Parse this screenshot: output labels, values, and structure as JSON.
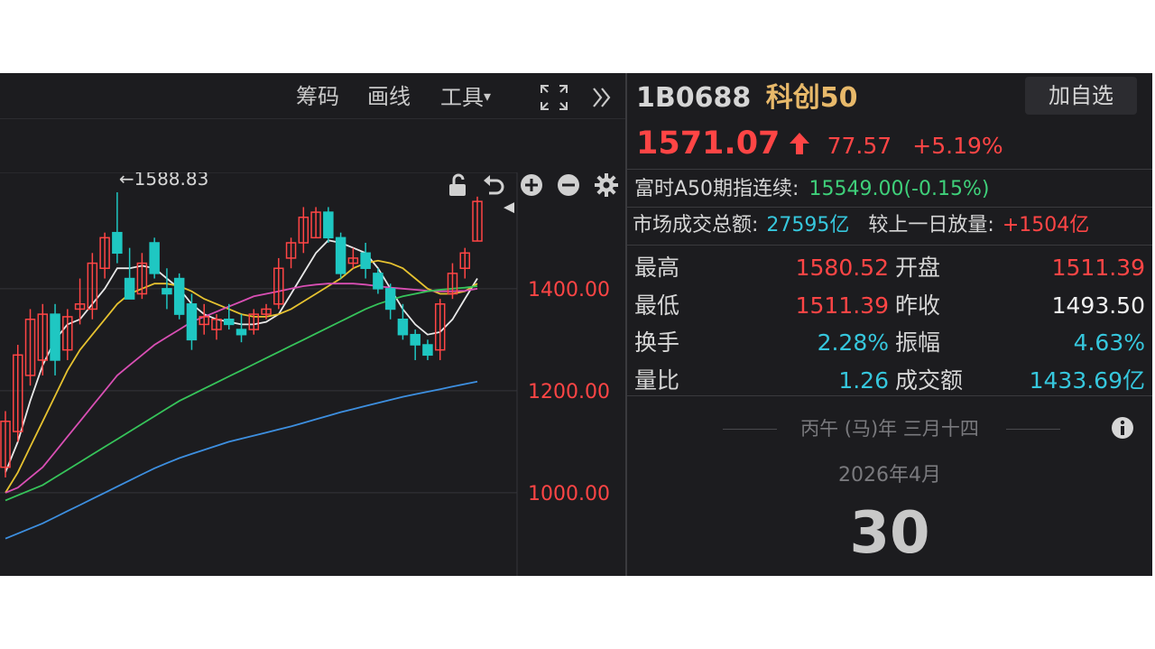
{
  "toolbar": {
    "chips_label": "筹码",
    "draw_label": "画线",
    "tools_label": "工具",
    "tools_caret": "▾",
    "expand_icon": "fullscreen-icon",
    "collapse_icon": "double-chevron-right-icon"
  },
  "subbar_icons": [
    "unlock-icon",
    "undo-icon",
    "zoom-in-icon",
    "zoom-out-icon",
    "gear-icon"
  ],
  "quote": {
    "code": "1B0688",
    "name": "科创50",
    "watch_button": "加自选",
    "price": "1571.07",
    "change": "77.57",
    "change_pct": "+5.19%",
    "a50_label": "富时A50期指连续:",
    "a50_value": "15549.00(-0.15%)",
    "turnover_label": "市场成交总额:",
    "turnover_value": "27595亿",
    "volume_diff_label": "较上一日放量:",
    "volume_diff_value": "+1504亿"
  },
  "stats": [
    {
      "label": "最高",
      "value": "1580.52",
      "color": "#ff4545",
      "label2": "开盘",
      "value2": "1511.39",
      "color2": "#ff4545"
    },
    {
      "label": "最低",
      "value": "1511.39",
      "color": "#ff4545",
      "label2": "昨收",
      "value2": "1493.50",
      "color2": "#f0f0f0"
    },
    {
      "label": "换手",
      "value": "2.28%",
      "color": "#36c7dd",
      "label2": "振幅",
      "value2": "4.63%",
      "color2": "#36c7dd"
    },
    {
      "label": "量比",
      "value": "1.26",
      "color": "#36c7dd",
      "label2": "成交额",
      "value2": "1433.69亿",
      "color2": "#36c7dd"
    }
  ],
  "calendar": {
    "lunar": "丙午 (马)年 三月十四",
    "month": "2026年4月",
    "day": "30"
  },
  "colors": {
    "up": "#ff4545",
    "down": "#1fc7c2",
    "ma5": "#e8e8e8",
    "ma10": "#e6c230",
    "ma20": "#d94fb4",
    "ma30": "#36c45a",
    "ma60": "#3d8fe0"
  },
  "chart_data": {
    "type": "candlestick",
    "y_ticks": [
      "1400.00",
      "1200.00",
      "1000.00"
    ],
    "y_tick_values": [
      1400,
      1200,
      1000
    ],
    "ylim": [
      837,
      1628
    ],
    "max_annotation": "←1588.83",
    "max_value": 1588.83,
    "candles": [
      {
        "o": 1050,
        "h": 1160,
        "l": 1030,
        "c": 1140
      },
      {
        "o": 1120,
        "h": 1290,
        "l": 1100,
        "c": 1270
      },
      {
        "o": 1230,
        "h": 1360,
        "l": 1210,
        "c": 1340
      },
      {
        "o": 1260,
        "h": 1370,
        "l": 1230,
        "c": 1350
      },
      {
        "o": 1350,
        "h": 1370,
        "l": 1230,
        "c": 1260
      },
      {
        "o": 1280,
        "h": 1360,
        "l": 1260,
        "c": 1345
      },
      {
        "o": 1360,
        "h": 1420,
        "l": 1330,
        "c": 1370
      },
      {
        "o": 1360,
        "h": 1470,
        "l": 1340,
        "c": 1450
      },
      {
        "o": 1440,
        "h": 1510,
        "l": 1420,
        "c": 1500
      },
      {
        "o": 1510,
        "h": 1589,
        "l": 1450,
        "c": 1470
      },
      {
        "o": 1420,
        "h": 1480,
        "l": 1400,
        "c": 1380
      },
      {
        "o": 1390,
        "h": 1470,
        "l": 1380,
        "c": 1450
      },
      {
        "o": 1490,
        "h": 1500,
        "l": 1420,
        "c": 1430
      },
      {
        "o": 1400,
        "h": 1440,
        "l": 1360,
        "c": 1390
      },
      {
        "o": 1420,
        "h": 1430,
        "l": 1340,
        "c": 1350
      },
      {
        "o": 1370,
        "h": 1390,
        "l": 1280,
        "c": 1300
      },
      {
        "o": 1330,
        "h": 1370,
        "l": 1310,
        "c": 1345
      },
      {
        "o": 1320,
        "h": 1350,
        "l": 1300,
        "c": 1340
      },
      {
        "o": 1340,
        "h": 1370,
        "l": 1320,
        "c": 1330
      },
      {
        "o": 1320,
        "h": 1350,
        "l": 1295,
        "c": 1310
      },
      {
        "o": 1320,
        "h": 1360,
        "l": 1310,
        "c": 1350
      },
      {
        "o": 1350,
        "h": 1370,
        "l": 1340,
        "c": 1360
      },
      {
        "o": 1370,
        "h": 1460,
        "l": 1360,
        "c": 1440
      },
      {
        "o": 1460,
        "h": 1500,
        "l": 1440,
        "c": 1490
      },
      {
        "o": 1490,
        "h": 1560,
        "l": 1470,
        "c": 1540
      },
      {
        "o": 1500,
        "h": 1560,
        "l": 1500,
        "c": 1550
      },
      {
        "o": 1550,
        "h": 1560,
        "l": 1490,
        "c": 1500
      },
      {
        "o": 1500,
        "h": 1510,
        "l": 1420,
        "c": 1430
      },
      {
        "o": 1450,
        "h": 1480,
        "l": 1440,
        "c": 1460
      },
      {
        "o": 1470,
        "h": 1490,
        "l": 1420,
        "c": 1440
      },
      {
        "o": 1430,
        "h": 1440,
        "l": 1390,
        "c": 1400
      },
      {
        "o": 1400,
        "h": 1410,
        "l": 1340,
        "c": 1360
      },
      {
        "o": 1340,
        "h": 1370,
        "l": 1300,
        "c": 1310
      },
      {
        "o": 1310,
        "h": 1320,
        "l": 1260,
        "c": 1290
      },
      {
        "o": 1290,
        "h": 1300,
        "l": 1260,
        "c": 1270
      },
      {
        "o": 1280,
        "h": 1380,
        "l": 1260,
        "c": 1370
      },
      {
        "o": 1390,
        "h": 1450,
        "l": 1380,
        "c": 1430
      },
      {
        "o": 1440,
        "h": 1480,
        "l": 1420,
        "c": 1470
      },
      {
        "o": 1493.5,
        "h": 1580.52,
        "l": 1493.5,
        "c": 1571.07
      }
    ],
    "ma_lines": [
      {
        "key": "ma5",
        "values": [
          1040,
          1100,
          1180,
          1250,
          1300,
          1330,
          1340,
          1370,
          1400,
          1440,
          1440,
          1445,
          1440,
          1420,
          1400,
          1370,
          1350,
          1340,
          1335,
          1330,
          1330,
          1335,
          1350,
          1390,
          1430,
          1470,
          1495,
          1490,
          1480,
          1470,
          1440,
          1400,
          1360,
          1330,
          1310,
          1315,
          1340,
          1380,
          1420
        ]
      },
      {
        "key": "ma10",
        "values": [
          1000,
          1040,
          1090,
          1140,
          1190,
          1240,
          1280,
          1310,
          1340,
          1370,
          1390,
          1400,
          1410,
          1410,
          1405,
          1395,
          1380,
          1370,
          1360,
          1350,
          1345,
          1345,
          1350,
          1360,
          1375,
          1390,
          1405,
          1420,
          1440,
          1450,
          1455,
          1450,
          1440,
          1420,
          1400,
          1390,
          1390,
          1395,
          1410
        ]
      },
      {
        "key": "ma20",
        "values": [
          1000,
          1010,
          1030,
          1050,
          1080,
          1110,
          1140,
          1170,
          1200,
          1230,
          1250,
          1270,
          1290,
          1305,
          1320,
          1335,
          1345,
          1355,
          1365,
          1375,
          1385,
          1390,
          1395,
          1400,
          1405,
          1408,
          1410,
          1410,
          1410,
          1408,
          1405,
          1402,
          1400,
          1398,
          1396,
          1395,
          1395,
          1396,
          1400
        ]
      },
      {
        "key": "ma30",
        "values": [
          985,
          995,
          1005,
          1015,
          1030,
          1045,
          1060,
          1075,
          1090,
          1105,
          1120,
          1135,
          1150,
          1165,
          1180,
          1192,
          1204,
          1216,
          1228,
          1240,
          1252,
          1264,
          1276,
          1288,
          1300,
          1312,
          1324,
          1336,
          1348,
          1360,
          1370,
          1378,
          1385,
          1390,
          1395,
          1398,
          1400,
          1402,
          1405
        ]
      },
      {
        "key": "ma60",
        "values": [
          910,
          920,
          930,
          940,
          952,
          964,
          976,
          988,
          1000,
          1012,
          1024,
          1036,
          1048,
          1058,
          1068,
          1076,
          1084,
          1092,
          1100,
          1106,
          1112,
          1118,
          1124,
          1130,
          1137,
          1144,
          1151,
          1158,
          1164,
          1170,
          1176,
          1182,
          1188,
          1193,
          1198,
          1203,
          1208,
          1213,
          1218
        ]
      }
    ]
  }
}
